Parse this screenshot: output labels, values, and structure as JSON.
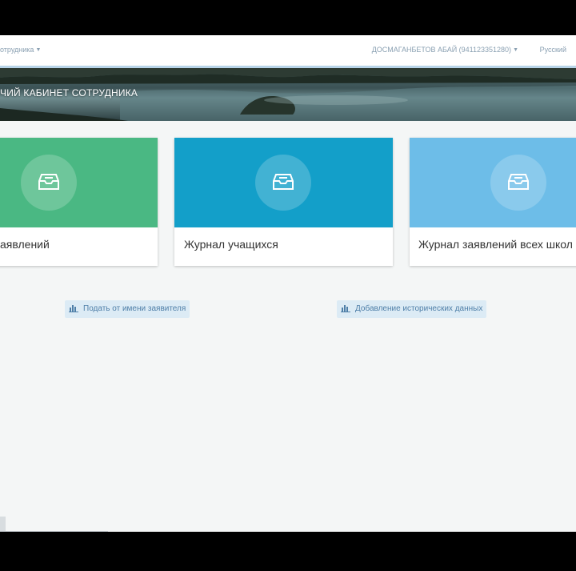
{
  "nav": {
    "left_menu": "отрудника",
    "user": "ДОСМАГАНБЕТОВ АБАЙ (941123351280)",
    "language": "Русский"
  },
  "banner": {
    "title": "ЧИЙ КАБИНЕТ СОТРУДНИКА"
  },
  "cards": [
    {
      "label": "аявлений",
      "color": "#4ab883",
      "icon": "inbox-icon"
    },
    {
      "label": "Журнал учащихся",
      "color": "#139fc9",
      "icon": "inbox-icon"
    },
    {
      "label": "Журнал заявлений всех школ",
      "color": "#6dbde8",
      "icon": "inbox-icon"
    }
  ],
  "actions": [
    {
      "label": "Подать от имени заявителя",
      "icon": "bar-chart-icon"
    },
    {
      "label": "Добавление исторических данных",
      "icon": "bar-chart-icon"
    }
  ]
}
